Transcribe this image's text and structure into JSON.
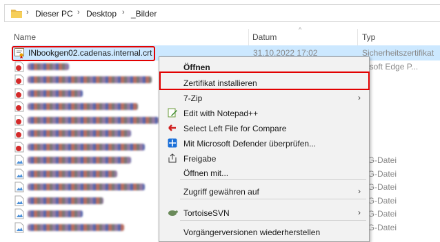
{
  "breadcrumb": {
    "items": [
      "Dieser PC",
      "Desktop",
      "_Bilder"
    ]
  },
  "columns": {
    "name": "Name",
    "date": "Datum",
    "type": "Typ"
  },
  "files": [
    {
      "name": "INbookgen02.cadenas.internal.crt",
      "date": "31.10.2022 17:02",
      "type": "Sicherheitszertifikat",
      "selected": true,
      "icon": "certificate-icon"
    },
    {
      "blurred": true,
      "type": "rosoft Edge P...",
      "icon": "edge-file-icon",
      "w": 60
    },
    {
      "blurred": true,
      "type": "",
      "icon": "edge-file-icon",
      "w": 180
    },
    {
      "blurred": true,
      "type": "",
      "icon": "edge-file-icon",
      "w": 80
    },
    {
      "blurred": true,
      "type": "",
      "icon": "edge-file-icon",
      "w": 160
    },
    {
      "blurred": true,
      "type": "",
      "icon": "edge-file-icon",
      "w": 190
    },
    {
      "blurred": true,
      "type": "",
      "icon": "edge-file-icon",
      "w": 150
    },
    {
      "blurred": true,
      "type": "",
      "icon": "edge-file-icon",
      "w": 170
    },
    {
      "blurred": true,
      "type": "NG-Datei",
      "icon": "png-file-icon",
      "w": 150
    },
    {
      "blurred": true,
      "type": "NG-Datei",
      "icon": "png-file-icon",
      "w": 130
    },
    {
      "blurred": true,
      "type": "NG-Datei",
      "icon": "png-file-icon",
      "w": 170
    },
    {
      "blurred": true,
      "type": "NG-Datei",
      "icon": "png-file-icon",
      "w": 110
    },
    {
      "blurred": true,
      "type": "NG-Datei",
      "icon": "png-file-icon",
      "w": 80
    },
    {
      "blurred": true,
      "type": "NG-Datei",
      "icon": "png-file-icon",
      "w": 140
    }
  ],
  "context_menu": {
    "items": [
      {
        "label": "Öffnen",
        "bold": true
      },
      {
        "label": "Zertifikat installieren"
      },
      {
        "label": "7-Zip",
        "submenu": true
      },
      {
        "label": "Edit with Notepad++",
        "icon": "notepad-icon"
      },
      {
        "label": "Select Left File for Compare",
        "icon": "compare-icon"
      },
      {
        "label": "Mit Microsoft Defender überprüfen...",
        "icon": "defender-icon"
      },
      {
        "label": "Freigabe",
        "icon": "share-icon"
      },
      {
        "label": "Öffnen mit..."
      },
      {
        "separator": true
      },
      {
        "label": "Zugriff gewähren auf",
        "submenu": true
      },
      {
        "separator": true
      },
      {
        "label": "TortoiseSVN",
        "icon": "tortoise-icon",
        "submenu": true
      },
      {
        "separator": true
      },
      {
        "label": "Vorgängerversionen wiederherstellen"
      }
    ]
  },
  "colors": {
    "selection": "#cce8ff",
    "highlight": "#e20000",
    "menu_bg": "#f2f2f2"
  }
}
